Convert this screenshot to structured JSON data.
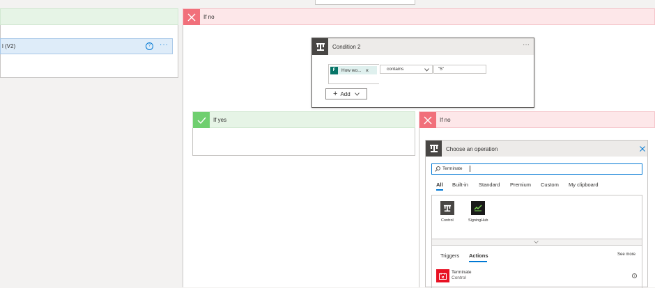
{
  "left_branch": {
    "action_title": "l (V2)"
  },
  "if_no_label": "If no",
  "condition": {
    "title": "Condition 2",
    "more": "···",
    "token_label": "How wo...",
    "token_remove": "×",
    "operator": "contains",
    "value": "\"5\"",
    "add_label": "Add"
  },
  "if_yes_label": "If yes",
  "inner_if_no_label": "If no",
  "operation_panel": {
    "title": "Choose an operation",
    "search_value": "Terminate",
    "tabs": [
      "All",
      "Built-in",
      "Standard",
      "Premium",
      "Custom",
      "My clipboard"
    ],
    "active_tab": "All",
    "connectors": [
      {
        "label": "Control",
        "icon": "control-icon"
      },
      {
        "label": "SigningHub",
        "icon": "signinghub-icon"
      }
    ],
    "subtabs": [
      "Triggers",
      "Actions"
    ],
    "active_subtab": "Actions",
    "see_more": "See more",
    "result": {
      "title": "Terminate",
      "subtitle": "Control",
      "icon": "terminate-icon"
    }
  },
  "colors": {
    "accent": "#0078d4",
    "yes": "#6fcf6f",
    "no": "#f1707b",
    "control": "#484644",
    "terminate": "#e81123"
  }
}
